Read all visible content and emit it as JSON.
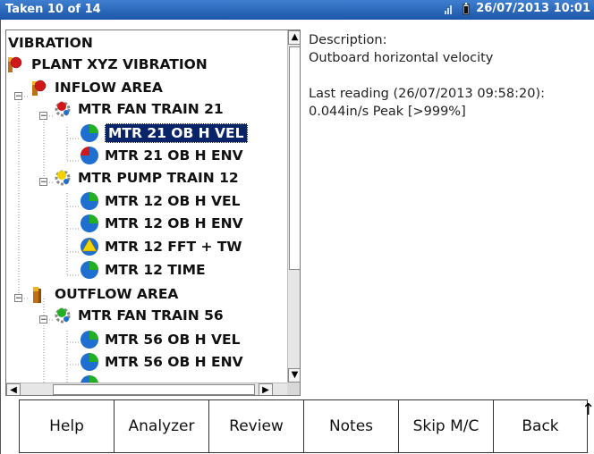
{
  "titlebar": {
    "title": "Taken 10 of 14",
    "datetime": "26/07/2013 10:01",
    "icons": [
      "signal-icon",
      "battery-icon"
    ]
  },
  "tree": {
    "items": [
      {
        "label": "VIBRATION",
        "icon": "none"
      },
      {
        "label": "PLANT XYZ VIBRATION",
        "icon": "plant-alarm-icon"
      },
      {
        "label": "INFLOW AREA",
        "icon": "area-alarm-icon"
      },
      {
        "label": "MTR FAN TRAIN 21",
        "icon": "machine-alarm-icon"
      },
      {
        "label": "MTR 21 OB H VEL",
        "icon": "point-done-icon",
        "selected": true
      },
      {
        "label": "MTR 21 OB H ENV",
        "icon": "point-alarm-icon"
      },
      {
        "label": "MTR PUMP TRAIN 12",
        "icon": "machine-warning-icon"
      },
      {
        "label": "MTR 12 OB H VEL",
        "icon": "point-done-icon"
      },
      {
        "label": "MTR 12 OB H ENV",
        "icon": "point-done-icon"
      },
      {
        "label": "MTR 12 FFT + TW",
        "icon": "point-warning-icon"
      },
      {
        "label": "MTR 12 TIME",
        "icon": "point-done-icon"
      },
      {
        "label": "OUTFLOW AREA",
        "icon": "area-ok-icon"
      },
      {
        "label": "MTR FAN TRAIN 56",
        "icon": "machine-ok-icon"
      },
      {
        "label": "MTR 56 OB H VEL",
        "icon": "point-done-icon"
      },
      {
        "label": "MTR 56 OB H ENV",
        "icon": "point-done-icon"
      }
    ]
  },
  "details": {
    "description_label": "Description:",
    "description_value": "Outboard horizontal velocity",
    "last_reading_label": "Last reading (26/07/2013 09:58:20):",
    "last_reading_value": "0.044in/s Peak [>999%]"
  },
  "toolbar": {
    "help": "Help",
    "analyzer": "Analyzer",
    "review": "Review",
    "notes": "Notes",
    "skip": "Skip M/C",
    "back": "Back"
  },
  "colors": {
    "titlebar": "#1c55a8",
    "selection": "#0a246a",
    "alarm_red": "#d01818",
    "warning_yellow": "#f2d200",
    "ok_green": "#22b022",
    "done_blue": "#1f6fd0"
  }
}
